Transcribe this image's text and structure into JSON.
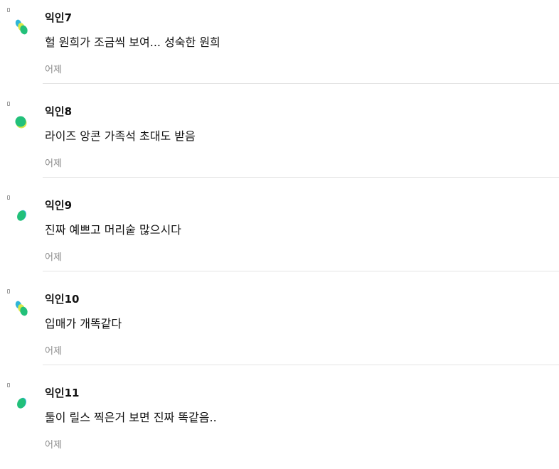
{
  "comments": [
    {
      "author": "익인7",
      "text": "헐 원희가 조금씩 보여... 성숙한 원희",
      "time": "어제",
      "avatar_icon": "leaf-cluster-icon"
    },
    {
      "author": "익인8",
      "text": "라이즈 앙콘 가족석 초대도 받음",
      "time": "어제",
      "avatar_icon": "green-blob-icon"
    },
    {
      "author": "익인9",
      "text": "진짜 예쁘고 머리숱 많으시다",
      "time": "어제",
      "avatar_icon": "green-oval-icon"
    },
    {
      "author": "익인10",
      "text": "입매가 개똑같다",
      "time": "어제",
      "avatar_icon": "leaf-cluster-icon"
    },
    {
      "author": "익인11",
      "text": "둘이 릴스 찍은거 보면 진짜 똑같음..",
      "time": "어제",
      "avatar_icon": "green-oval-icon"
    }
  ],
  "colors": {
    "avatar_green": "#22c07a",
    "avatar_teal": "#2fb5d8",
    "avatar_lime": "#d8e84a",
    "timestamp": "#8c8c8c",
    "divider": "#e4e4e4"
  }
}
